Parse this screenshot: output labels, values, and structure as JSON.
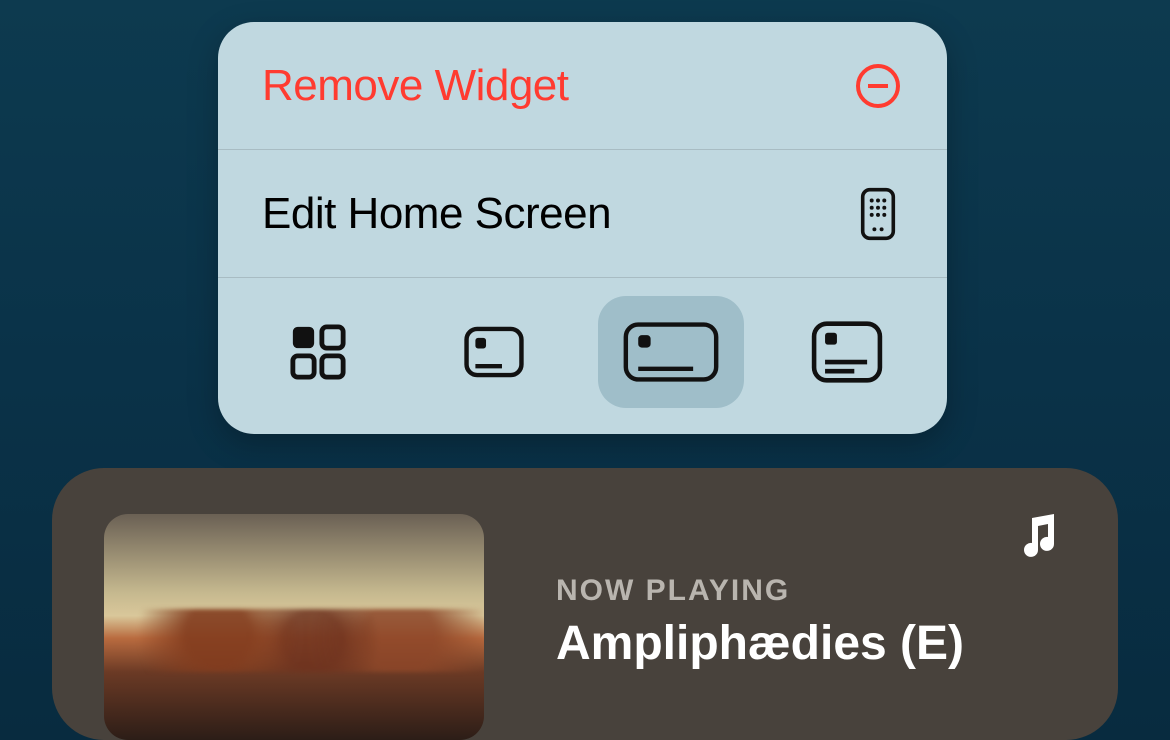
{
  "context_menu": {
    "remove_label": "Remove Widget",
    "edit_label": "Edit Home Screen",
    "sizes": {
      "selected_index": 2,
      "options": [
        "small-grid",
        "medium-card",
        "wide-card",
        "tall-card"
      ]
    }
  },
  "widget": {
    "app": "Music",
    "now_playing_label": "NOW PLAYING",
    "track_title": "Ampliphædies (E)"
  },
  "colors": {
    "destructive": "#ff3b30",
    "menu_bg": "#c0d8e0",
    "widget_bg": "#48423c"
  }
}
